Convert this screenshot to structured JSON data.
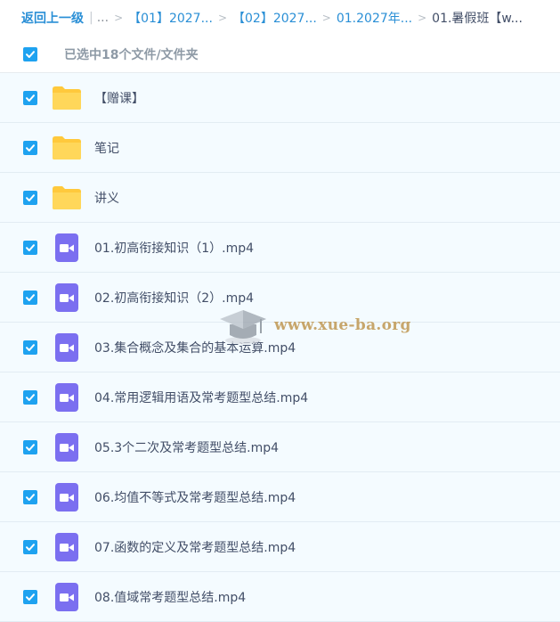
{
  "breadcrumb": {
    "back": "返回上一级",
    "bar": "|",
    "ellipsis": "...",
    "sep": ">",
    "items": [
      "【01】2027...",
      "【02】2027...",
      "01.2027年..."
    ],
    "current": "01.暑假班【w..."
  },
  "selection": {
    "text": "已选中18个文件/文件夹"
  },
  "files": [
    {
      "type": "folder",
      "name": "【赠课】"
    },
    {
      "type": "folder",
      "name": "笔记"
    },
    {
      "type": "folder",
      "name": "讲义"
    },
    {
      "type": "video",
      "name": "01.初高衔接知识（1）.mp4"
    },
    {
      "type": "video",
      "name": "02.初高衔接知识（2）.mp4"
    },
    {
      "type": "video",
      "name": "03.集合概念及集合的基本运算.mp4"
    },
    {
      "type": "video",
      "name": "04.常用逻辑用语及常考题型总结.mp4"
    },
    {
      "type": "video",
      "name": "05.3个二次及常考题型总结.mp4"
    },
    {
      "type": "video",
      "name": "06.均值不等式及常考题型总结.mp4"
    },
    {
      "type": "video",
      "name": "07.函数的定义及常考题型总结.mp4"
    },
    {
      "type": "video",
      "name": "08.值域常考题型总结.mp4"
    }
  ],
  "watermark": {
    "text": "www.xue-ba.org"
  },
  "colors": {
    "accent": "#1ea2f0",
    "link": "#2a8fd6",
    "folder": "#ffc93c",
    "video": "#7b6ff0",
    "row_bg": "#f4fbff"
  }
}
